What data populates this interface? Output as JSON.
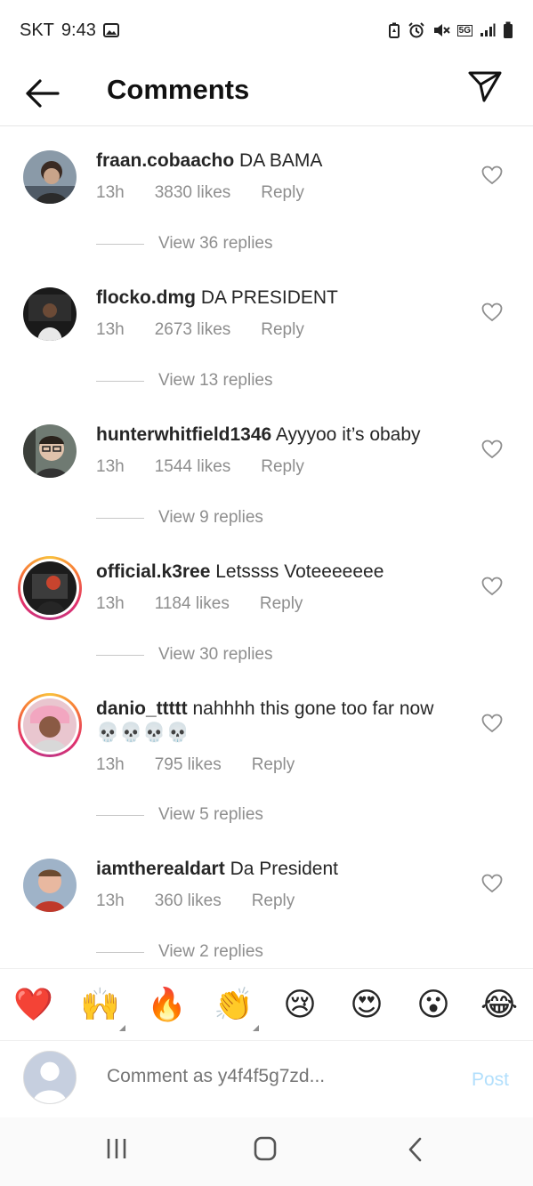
{
  "status_bar": {
    "carrier": "SKT",
    "time": "9:43",
    "network": "5G"
  },
  "header": {
    "title": "Comments"
  },
  "comments": [
    {
      "username": "fraan.cobaacho",
      "text": " DA BAMA",
      "age": "13h",
      "likes": "3830 likes",
      "reply": "Reply",
      "replies": "View 36 replies"
    },
    {
      "username": "flocko.dmg",
      "text": " DA PRESIDENT",
      "age": "13h",
      "likes": "2673 likes",
      "reply": "Reply",
      "replies": "View 13 replies"
    },
    {
      "username": "hunterwhitfield1346",
      "text": " Ayyyoo it’s obaby",
      "age": "13h",
      "likes": "1544 likes",
      "reply": "Reply",
      "replies": "View 9 replies"
    },
    {
      "username": "official.k3ree",
      "text": " Letssss Voteeeeeee",
      "age": "13h",
      "likes": "1184 likes",
      "reply": "Reply",
      "replies": "View 30 replies"
    },
    {
      "username": "danio_ttttt",
      "text": " nahhhh this gone too far now 💀💀💀💀",
      "age": "13h",
      "likes": "795 likes",
      "reply": "Reply",
      "replies": "View 5 replies"
    },
    {
      "username": "iamtherealdart",
      "text": " Da President",
      "age": "13h",
      "likes": "360 likes",
      "reply": "Reply",
      "replies": "View 2 replies"
    }
  ],
  "emoji_bar": [
    "❤️",
    "🙌",
    "🔥",
    "👏",
    "😢",
    "😍",
    "😮",
    "😂"
  ],
  "comment_box": {
    "placeholder": "Comment as y4f4f5g7zd...",
    "post_label": "Post"
  },
  "colors": {
    "post_disabled": "#b2dffc",
    "secondary_text": "#8e8e8e"
  }
}
